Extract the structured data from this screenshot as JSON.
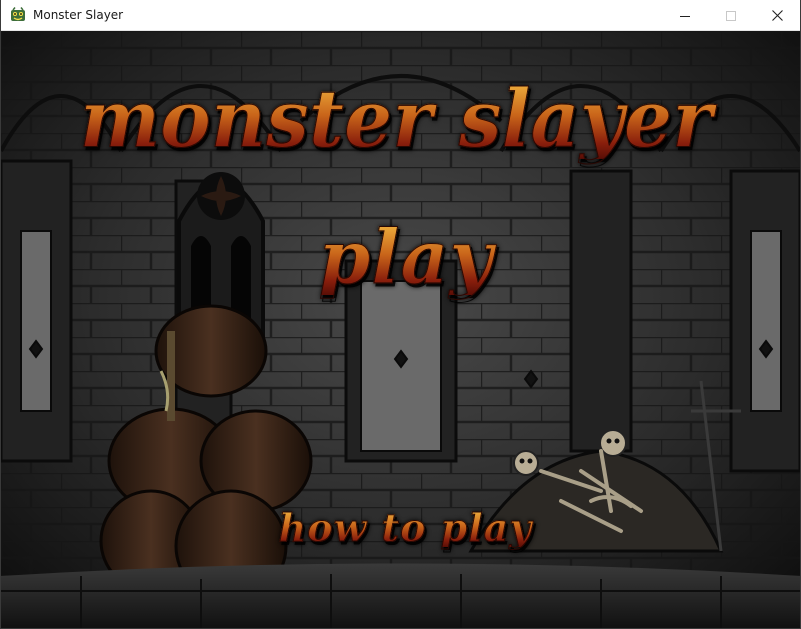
{
  "window": {
    "title": "Monster Slayer",
    "controls": {
      "minimize_icon": "minimize-icon",
      "maximize_icon": "maximize-icon",
      "close_icon": "close-icon"
    }
  },
  "game": {
    "title": "MONSTER SLAYER",
    "menu": {
      "play_label": "PLAY",
      "how_to_play_label": "HOW TO PLAY"
    },
    "colors": {
      "text_gold": "#f2b640",
      "text_red": "#8a1f0c",
      "background_stone": "#262626"
    }
  }
}
